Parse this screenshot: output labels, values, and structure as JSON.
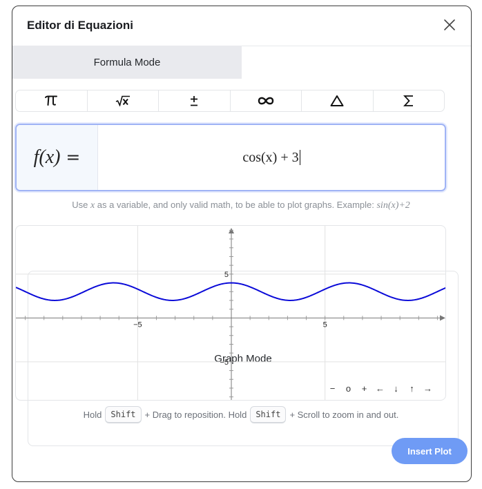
{
  "dialog": {
    "title": "Editor di Equazioni",
    "close_icon": "close-icon"
  },
  "tabs": [
    {
      "label": "Formula Mode",
      "active": false
    },
    {
      "label": "Graph Mode",
      "active": true
    }
  ],
  "toolbar": {
    "symbols": [
      {
        "name": "pi-icon",
        "label": "π"
      },
      {
        "name": "square-root-icon",
        "label": "√x"
      },
      {
        "name": "plus-minus-icon",
        "label": "±"
      },
      {
        "name": "infinity-icon",
        "label": "∞"
      },
      {
        "name": "delta-icon",
        "label": "Δ"
      },
      {
        "name": "sigma-icon",
        "label": "Σ"
      }
    ]
  },
  "formula": {
    "prefix": "f(x) =",
    "expression": "cos(x) + 3"
  },
  "hint": {
    "text_before": "Use",
    "var": "x",
    "text_after": "as a variable, and only valid math, to be able to plot graphs. Example:",
    "example": "sin(x)+2"
  },
  "graph": {
    "tick_labels": {
      "x_neg": "−5",
      "x_pos": "5",
      "y_pos": "5",
      "y_neg": "−5"
    },
    "controls": [
      "−",
      "o",
      "+",
      "←",
      "↓",
      "↑",
      "→"
    ]
  },
  "chart_data": {
    "type": "line",
    "function": "cos(x) + 3",
    "xlim": [
      -11.5,
      11.5
    ],
    "ylim": [
      -9.5,
      10.5
    ],
    "x_ticks": [
      -5,
      5
    ],
    "y_ticks": [
      -5,
      5
    ],
    "grid": true,
    "series_color": "#0a0ad8"
  },
  "bottom_hint": {
    "part1": "Hold",
    "key1": "Shift",
    "part2": "+ Drag to reposition. Hold",
    "key2": "Shift",
    "part3": "+ Scroll to zoom in and out."
  },
  "actions": {
    "insert_label": "Insert Plot"
  },
  "colors": {
    "accent": "#6f9bf5",
    "formula_border": "#9fb3f5",
    "tab_inactive_bg": "#e9eaee"
  }
}
